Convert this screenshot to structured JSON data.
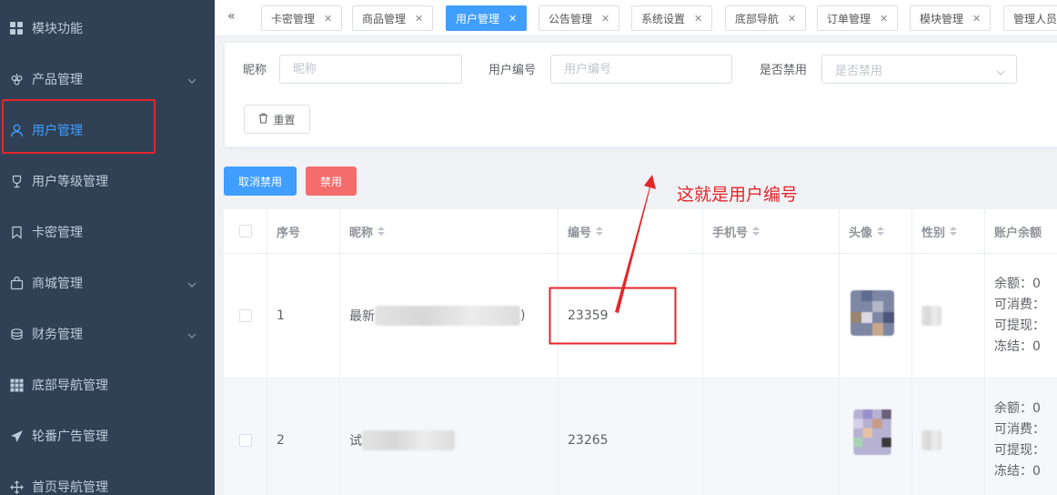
{
  "sidebar": {
    "items": [
      {
        "label": "模块功能",
        "icon": "grid-icon"
      },
      {
        "label": "产品管理",
        "icon": "grape-icon",
        "has_children": true
      },
      {
        "label": "用户管理",
        "icon": "user-icon",
        "active": true
      },
      {
        "label": "用户等级管理",
        "icon": "trophy-icon"
      },
      {
        "label": "卡密管理",
        "icon": "bookmark-icon"
      },
      {
        "label": "商城管理",
        "icon": "bag-icon",
        "has_children": true
      },
      {
        "label": "财务管理",
        "icon": "coins-icon",
        "has_children": true
      },
      {
        "label": "底部导航管理",
        "icon": "apps-icon"
      },
      {
        "label": "轮番广告管理",
        "icon": "send-icon"
      },
      {
        "label": "首页导航管理",
        "icon": "move-icon"
      }
    ]
  },
  "tabs": [
    {
      "label": "卡密管理"
    },
    {
      "label": "商品管理"
    },
    {
      "label": "用户管理",
      "active": true
    },
    {
      "label": "公告管理"
    },
    {
      "label": "系统设置"
    },
    {
      "label": "底部导航"
    },
    {
      "label": "订单管理"
    },
    {
      "label": "模块管理"
    },
    {
      "label": "管理人员"
    }
  ],
  "tabs_collapse": "«",
  "search": {
    "nickname_label": "昵称",
    "nickname_placeholder": "昵称",
    "userid_label": "用户编号",
    "userid_placeholder": "用户编号",
    "banned_label": "是否禁用",
    "banned_placeholder": "是否禁用",
    "reset_label": "重置"
  },
  "actions": {
    "unban_label": "取消禁用",
    "ban_label": "禁用"
  },
  "annotation": {
    "text": "这就是用户编号"
  },
  "table": {
    "columns": [
      "序号",
      "昵称",
      "编号",
      "手机号",
      "头像",
      "性别",
      "账户余额"
    ],
    "rows": [
      {
        "index": "1",
        "nickname_prefix": "最新",
        "nickname_suffix": ")",
        "id": "23359",
        "phone": "",
        "balance": [
          "余额：0",
          "可消费：",
          "可提现：",
          "冻结：0"
        ]
      },
      {
        "index": "2",
        "nickname_prefix": "试",
        "nickname_suffix": "",
        "id": "23265",
        "phone": "",
        "balance": [
          "余额：0",
          "可消费：",
          "可提现：",
          "冻结：0"
        ]
      }
    ]
  },
  "colors": {
    "sidebar_bg": "#304156",
    "primary": "#409eff",
    "danger": "#f56c6c",
    "annotation_red": "#e4262b"
  }
}
